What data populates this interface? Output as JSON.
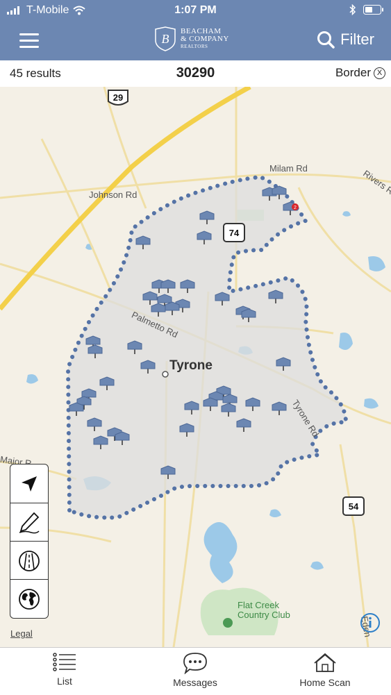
{
  "status_bar": {
    "carrier": "T-Mobile",
    "time": "1:07 PM"
  },
  "nav": {
    "logo_line1": "BEACHAM",
    "logo_line2": "& COMPANY",
    "logo_line3": "REALTORS",
    "logo_letter": "B",
    "filter_label": "Filter"
  },
  "results_bar": {
    "count": "45 results",
    "zip": "30290",
    "border_label": "Border",
    "border_close": "X"
  },
  "map": {
    "roads": {
      "milam": "Milam Rd",
      "johnson": "Johnson Rd",
      "rivers": "Rivers R",
      "palmetto": "Palmetto Rd",
      "tyrone_rd": "Tyrone Rd",
      "major": "Major R",
      "edens": "Eden"
    },
    "town": "Tyrone",
    "poi": "Flat Creek Country Club",
    "poi_line1": "Flat Creek",
    "poi_line2": "Country Club",
    "shields": {
      "us29": "29",
      "sr74": "74",
      "sr54": "54"
    },
    "cluster_badge": "2",
    "legal": "Legal",
    "colors": {
      "land": "#f4f0e6",
      "water": "#9cc9e8",
      "highway": "#f3d04a",
      "border_dots": "#5573a6",
      "pin": "#6c87b2",
      "shade": "#dedede"
    }
  },
  "map_tools": [
    "location-arrow-icon",
    "draw-pencil-icon",
    "road-icon",
    "globe-icon"
  ],
  "tabs": [
    {
      "label": "List",
      "icon": "list-icon"
    },
    {
      "label": "Messages",
      "icon": "chat-bubble-icon"
    },
    {
      "label": "Home Scan",
      "icon": "house-scan-icon"
    }
  ]
}
